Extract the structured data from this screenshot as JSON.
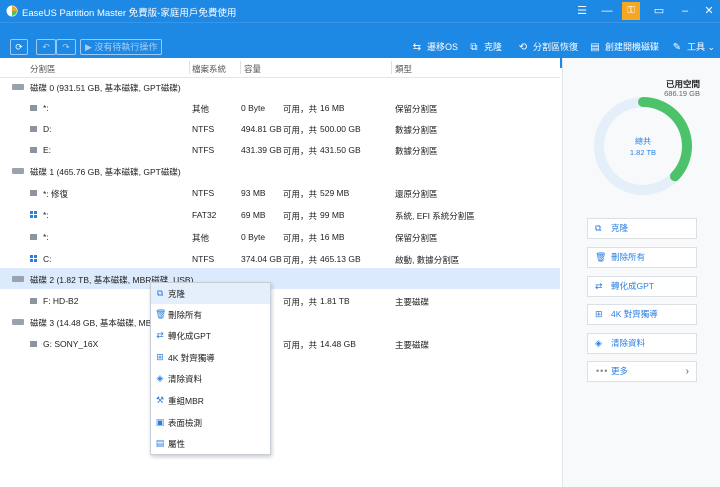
{
  "window": {
    "title": "EaseUS Partition Master 免費版-家庭用戶免費使用",
    "controls": [
      "menu-icon",
      "minimize-icon",
      "key-icon",
      "restore-icon",
      "close-icon"
    ]
  },
  "toolbar": {
    "pending_label": "沒有待執行操作",
    "items": [
      {
        "icon": "migrate-os-icon",
        "label": "遷移OS"
      },
      {
        "icon": "clone-icon",
        "label": "克隆"
      },
      {
        "icon": "partition-recovery-icon",
        "label": "分割區恢復"
      },
      {
        "icon": "bootable-media-icon",
        "label": "創建開機磁碟"
      },
      {
        "icon": "tools-icon",
        "label": "工具"
      }
    ]
  },
  "columns": {
    "partition": "分割區",
    "filesystem": "檔案系統",
    "capacity": "容量",
    "type": "類型"
  },
  "disks": [
    {
      "label": "磁碟 0 (931.51 GB, 基本磁碟, GPT磁碟)",
      "partitions": [
        {
          "name": "*:",
          "fs": "其他",
          "used": "0 Byte",
          "free_prefix": "可用，共",
          "total": "16 MB",
          "type": "保留分割區",
          "icon": "drive-icon"
        },
        {
          "name": "D:",
          "fs": "NTFS",
          "used": "494.81 GB",
          "free_prefix": "可用，共",
          "total": "500.00 GB",
          "type": "數據分割區",
          "icon": "drive-icon"
        },
        {
          "name": "E:",
          "fs": "NTFS",
          "used": "431.39 GB",
          "free_prefix": "可用，共",
          "total": "431.50 GB",
          "type": "數據分割區",
          "icon": "drive-icon"
        }
      ]
    },
    {
      "label": "磁碟 1 (465.76 GB, 基本磁碟, GPT磁碟)",
      "partitions": [
        {
          "name": "*: 修復",
          "fs": "NTFS",
          "used": "93 MB",
          "free_prefix": "可用，共",
          "total": "529 MB",
          "type": "還原分割區",
          "icon": "drive-icon"
        },
        {
          "name": "*:",
          "fs": "FAT32",
          "used": "69 MB",
          "free_prefix": "可用，共",
          "total": "99 MB",
          "type": "系統, EFI 系統分割區",
          "icon": "windows-drive-icon"
        },
        {
          "name": "*:",
          "fs": "其他",
          "used": "0 Byte",
          "free_prefix": "可用，共",
          "total": "16 MB",
          "type": "保留分割區",
          "icon": "drive-icon"
        },
        {
          "name": "C:",
          "fs": "NTFS",
          "used": "374.04 GB",
          "free_prefix": "可用，共",
          "total": "465.13 GB",
          "type": "啟動, 數據分割區",
          "icon": "windows-drive-icon"
        }
      ]
    },
    {
      "label": "磁碟 2 (1.82 TB, 基本磁碟, MBR磁碟, USB)",
      "partitions": [
        {
          "name": "F: HD-B2",
          "fs": "",
          "used": "",
          "free_prefix": "可用，共",
          "total": "1.81 TB",
          "type": "主要磁碟",
          "icon": "drive-icon"
        }
      ]
    },
    {
      "label": "磁碟 3 (14.48 GB, 基本磁碟, MBR",
      "partitions": [
        {
          "name": "G: SONY_16X",
          "fs": "",
          "used": "",
          "free_prefix": "可用，共",
          "total": "14.48 GB",
          "type": "主要磁碟",
          "icon": "drive-icon"
        }
      ]
    }
  ],
  "context_menu": [
    {
      "icon": "clone-icon",
      "label": "克隆"
    },
    {
      "icon": "delete-icon",
      "label": "刪除所有"
    },
    {
      "icon": "convert-icon",
      "label": "轉化成GPT"
    },
    {
      "icon": "align-icon",
      "label": "4K 對齊獨導"
    },
    {
      "icon": "wipe-icon",
      "label": "清除資料"
    },
    {
      "icon": "rebuild-mbr-icon",
      "label": "重組MBR"
    },
    {
      "icon": "surface-test-icon",
      "label": "表面檢測"
    },
    {
      "icon": "properties-icon",
      "label": "屬性"
    }
  ],
  "right_panel": {
    "used_label": "已用空間",
    "used_size": "686.19 GB",
    "total_label": "總共",
    "total_size": "1.82 TB",
    "used_fraction": 0.37,
    "actions": [
      {
        "icon": "clone-icon",
        "label": "克隆"
      },
      {
        "icon": "delete-icon",
        "label": "刪除所有"
      },
      {
        "icon": "convert-icon",
        "label": "轉化成GPT"
      },
      {
        "icon": "align-icon",
        "label": "4K 對齊獨導"
      },
      {
        "icon": "wipe-icon",
        "label": "清除資料"
      }
    ],
    "more_label": "更多"
  },
  "colors": {
    "accent": "#1e88e5",
    "donut_used": "#4cc36a",
    "donut_track": "#e4eff9",
    "selection": "#dbeafc"
  }
}
